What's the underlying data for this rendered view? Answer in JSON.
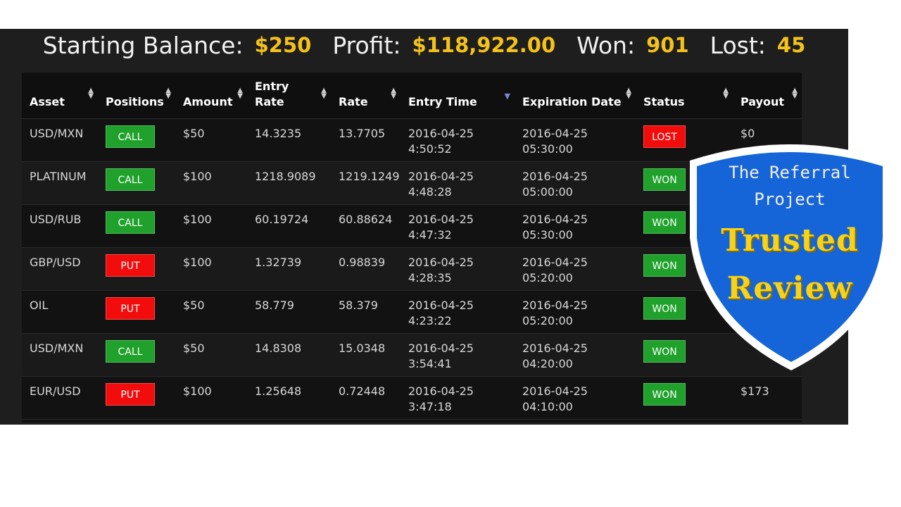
{
  "summary": {
    "starting_balance_label": "Starting Balance:",
    "starting_balance_value": "$250",
    "profit_label": "Profit:",
    "profit_value": "$118,922.00",
    "won_label": "Won:",
    "won_value": "901",
    "lost_label": "Lost:",
    "lost_value": "45"
  },
  "table": {
    "headers": [
      "Asset",
      "Positions",
      "Amount",
      "Entry Rate",
      "Rate",
      "Entry Time",
      "Expiration Date",
      "Status",
      "Payout"
    ],
    "header_entry_rate_line1": "Entry",
    "header_entry_rate_line2": "Rate",
    "rows": [
      {
        "asset": "USD/MXN",
        "position": "CALL",
        "amount": "$50",
        "entry_rate": "14.3235",
        "rate": "13.7705",
        "entry_date": "2016-04-25",
        "entry_time": "4:50:52",
        "exp_date": "2016-04-25",
        "exp_time": "05:30:00",
        "status": "LOST",
        "payout": "$0"
      },
      {
        "asset": "PLATINUM",
        "position": "CALL",
        "amount": "$100",
        "entry_rate": "1218.9089",
        "rate": "1219.1249",
        "entry_date": "2016-04-25",
        "entry_time": "4:48:28",
        "exp_date": "2016-04-25",
        "exp_time": "05:00:00",
        "status": "WON",
        "payout": ""
      },
      {
        "asset": "USD/RUB",
        "position": "CALL",
        "amount": "$100",
        "entry_rate": "60.19724",
        "rate": "60.88624",
        "entry_date": "2016-04-25",
        "entry_time": "4:47:32",
        "exp_date": "2016-04-25",
        "exp_time": "05:30:00",
        "status": "WON",
        "payout": ""
      },
      {
        "asset": "GBP/USD",
        "position": "PUT",
        "amount": "$100",
        "entry_rate": "1.32739",
        "rate": "0.98839",
        "entry_date": "2016-04-25",
        "entry_time": "4:28:35",
        "exp_date": "2016-04-25",
        "exp_time": "05:20:00",
        "status": "WON",
        "payout": ""
      },
      {
        "asset": "OIL",
        "position": "PUT",
        "amount": "$50",
        "entry_rate": "58.779",
        "rate": "58.379",
        "entry_date": "2016-04-25",
        "entry_time": "4:23:22",
        "exp_date": "2016-04-25",
        "exp_time": "05:20:00",
        "status": "WON",
        "payout": ""
      },
      {
        "asset": "USD/MXN",
        "position": "CALL",
        "amount": "$50",
        "entry_rate": "14.8308",
        "rate": "15.0348",
        "entry_date": "2016-04-25",
        "entry_time": "3:54:41",
        "exp_date": "2016-04-25",
        "exp_time": "04:20:00",
        "status": "WON",
        "payout": ""
      },
      {
        "asset": "EUR/USD",
        "position": "PUT",
        "amount": "$100",
        "entry_rate": "1.25648",
        "rate": "0.72448",
        "entry_date": "2016-04-25",
        "entry_time": "3:47:18",
        "exp_date": "2016-04-25",
        "exp_time": "04:10:00",
        "status": "WON",
        "payout": "$173"
      }
    ]
  },
  "badge": {
    "line1": "The Referral",
    "line2": "Project",
    "line3": "Trusted",
    "line4": "Review"
  },
  "colors": {
    "accent_yellow": "#f5c21b",
    "call_green": "#1fa12b",
    "put_red": "#f20c0c",
    "badge_blue": "#1565d8"
  }
}
